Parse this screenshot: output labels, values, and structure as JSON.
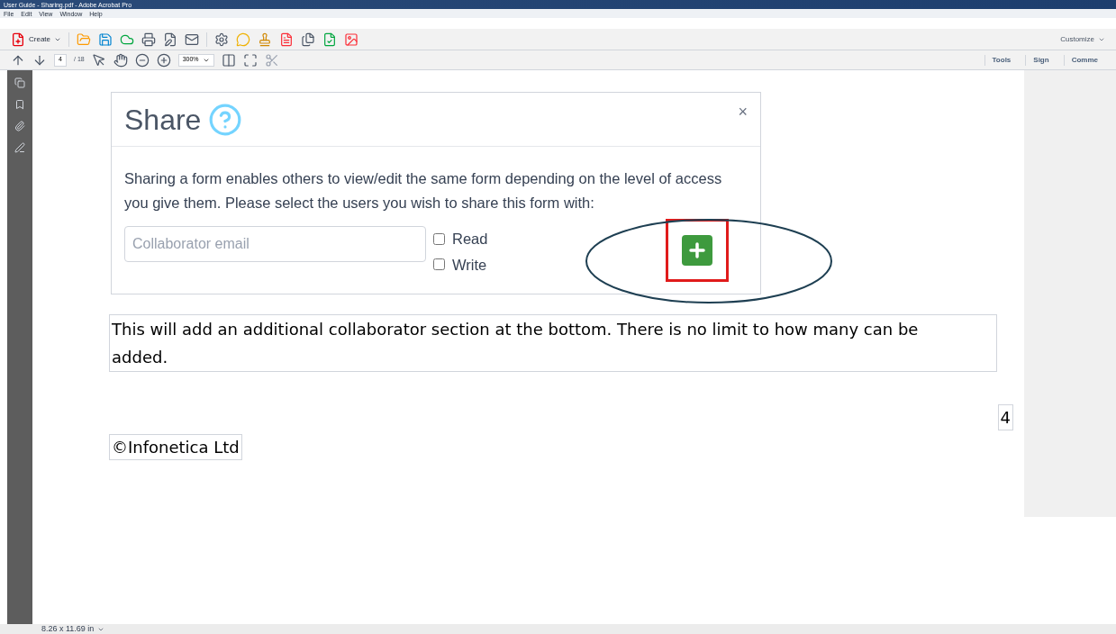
{
  "window": {
    "title": "User Guide - Sharing.pdf - Adobe Acrobat Pro"
  },
  "menu": [
    "File",
    "Edit",
    "View",
    "Window",
    "Help"
  ],
  "toolbar": {
    "create": "Create",
    "customize": "Customize"
  },
  "nav": {
    "page": "4",
    "page_count": "/ 18",
    "zoom": "300%"
  },
  "panes": [
    {
      "label": "Tools",
      "selected": false
    },
    {
      "label": "Sign",
      "selected": false
    },
    {
      "label": "Comme",
      "selected": false
    }
  ],
  "dialog": {
    "title": "Share",
    "close": "×",
    "message": "Sharing a form enables others to view/edit the same form depending on the level of access you give them. Please select the users you wish to share this form with:",
    "email": {
      "placeholder": "Collaborator email"
    },
    "permissions": [
      {
        "label": "Read",
        "checked": false
      },
      {
        "label": "Write",
        "checked": false
      }
    ],
    "add_highlighted": true
  },
  "note": "This will add an additional collaborator section at the bottom. There is no limit to how many can be added.",
  "page_number": "4",
  "footer": "©Infonetica Ltd",
  "status_bar": {
    "page_size": "8.26 x 11.69 in"
  }
}
